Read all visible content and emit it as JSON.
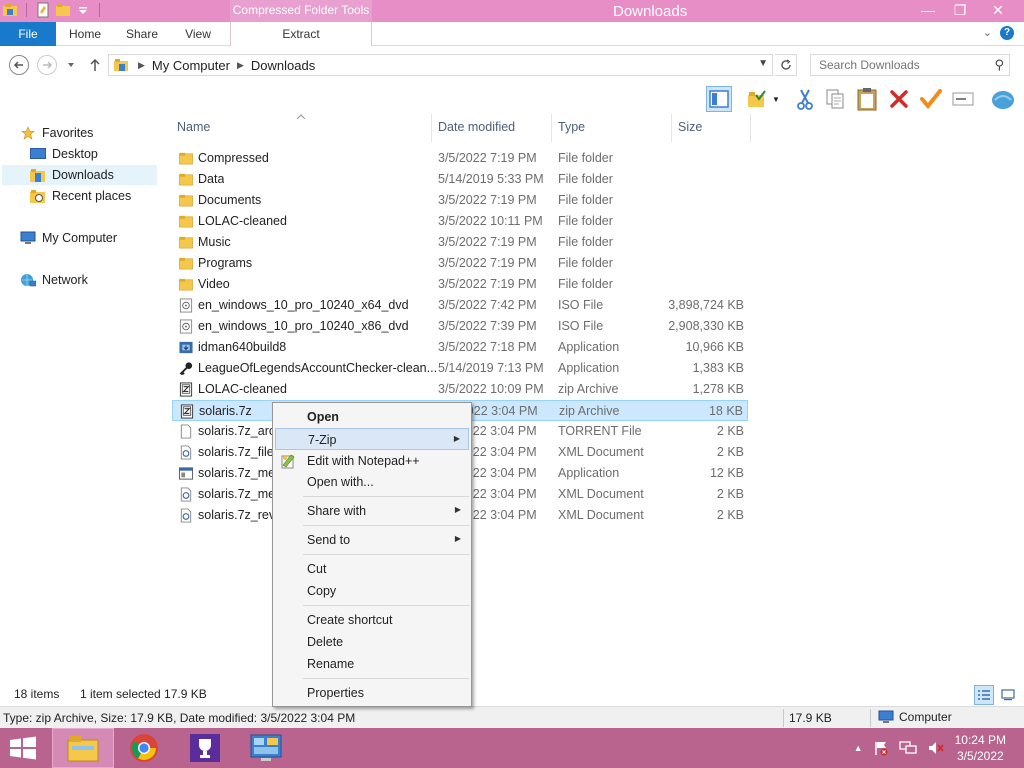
{
  "window": {
    "title": "Downloads",
    "context_tab": "Compressed Folder Tools",
    "minimize_glyph": "—",
    "maximize_glyph": "❐",
    "close_glyph": "✕"
  },
  "ribbon": {
    "tabs": [
      {
        "label": "File"
      },
      {
        "label": "Home"
      },
      {
        "label": "Share"
      },
      {
        "label": "View"
      },
      {
        "label": "Extract"
      }
    ],
    "help_glyph": "?",
    "collapse_glyph": "⌄"
  },
  "address": {
    "crumbs": [
      "My Computer",
      "Downloads"
    ],
    "search_placeholder": "Search Downloads"
  },
  "nav": {
    "favorites": "Favorites",
    "desktop": "Desktop",
    "downloads": "Downloads",
    "recent": "Recent places",
    "computer": "My Computer",
    "network": "Network"
  },
  "columns": {
    "name": "Name",
    "date": "Date modified",
    "type": "Type",
    "size": "Size"
  },
  "files": [
    {
      "name": "Compressed",
      "date": "3/5/2022 7:19 PM",
      "type": "File folder",
      "size": "",
      "icon": "folder-icon"
    },
    {
      "name": "Data",
      "date": "5/14/2019 5:33 PM",
      "type": "File folder",
      "size": "",
      "icon": "folder-icon"
    },
    {
      "name": "Documents",
      "date": "3/5/2022 7:19 PM",
      "type": "File folder",
      "size": "",
      "icon": "folder-icon"
    },
    {
      "name": "LOLAC-cleaned",
      "date": "3/5/2022 10:11 PM",
      "type": "File folder",
      "size": "",
      "icon": "folder-icon"
    },
    {
      "name": "Music",
      "date": "3/5/2022 7:19 PM",
      "type": "File folder",
      "size": "",
      "icon": "folder-icon"
    },
    {
      "name": "Programs",
      "date": "3/5/2022 7:19 PM",
      "type": "File folder",
      "size": "",
      "icon": "folder-icon"
    },
    {
      "name": "Video",
      "date": "3/5/2022 7:19 PM",
      "type": "File folder",
      "size": "",
      "icon": "folder-icon"
    },
    {
      "name": "en_windows_10_pro_10240_x64_dvd",
      "date": "3/5/2022 7:42 PM",
      "type": "ISO File",
      "size": "3,898,724 KB",
      "icon": "disc-image-icon"
    },
    {
      "name": "en_windows_10_pro_10240_x86_dvd",
      "date": "3/5/2022 7:39 PM",
      "type": "ISO File",
      "size": "2,908,330 KB",
      "icon": "disc-image-icon"
    },
    {
      "name": "idman640build8",
      "date": "3/5/2022 7:18 PM",
      "type": "Application",
      "size": "10,966 KB",
      "icon": "installer-icon"
    },
    {
      "name": "LeagueOfLegendsAccountChecker-clean...",
      "date": "5/14/2019 7:13 PM",
      "type": "Application",
      "size": "1,383 KB",
      "icon": "key-icon"
    },
    {
      "name": "LOLAC-cleaned",
      "date": "3/5/2022 10:09 PM",
      "type": "zip Archive",
      "size": "1,278 KB",
      "icon": "zip-icon"
    },
    {
      "name": "solaris.7z",
      "date": "3/5/2022 3:04 PM",
      "type": "zip Archive",
      "size": "18 KB",
      "icon": "zip-icon"
    },
    {
      "name": "solaris.7z_archive.torrent",
      "date": "3/5/2022 3:04 PM",
      "type": "TORRENT File",
      "size": "2 KB",
      "icon": "blank-file-icon"
    },
    {
      "name": "solaris.7z_files.xml",
      "date": "3/5/2022 3:04 PM",
      "type": "XML Document",
      "size": "2 KB",
      "icon": "xml-icon"
    },
    {
      "name": "solaris.7z_meta.sqlite",
      "date": "3/5/2022 3:04 PM",
      "type": "Application",
      "size": "12 KB",
      "icon": "app-file-icon"
    },
    {
      "name": "solaris.7z_meta.xml",
      "date": "3/5/2022 3:04 PM",
      "type": "XML Document",
      "size": "2 KB",
      "icon": "xml-icon"
    },
    {
      "name": "solaris.7z_reviews.xml",
      "date": "3/5/2022 3:04 PM",
      "type": "XML Document",
      "size": "2 KB",
      "icon": "xml-icon"
    }
  ],
  "context_menu": {
    "open": "Open",
    "sevenzip": "7-Zip",
    "notepad": "Edit with Notepad++",
    "openwith": "Open with...",
    "sharewith": "Share with",
    "sendto": "Send to",
    "cut": "Cut",
    "copy": "Copy",
    "shortcut": "Create shortcut",
    "delete": "Delete",
    "rename": "Rename",
    "properties": "Properties",
    "submenu_arrow": "▶"
  },
  "status": {
    "items": "18 items",
    "selected": "1 item selected  17.9 KB"
  },
  "details": {
    "info": "Type: zip Archive, Size: 17.9 KB, Date modified: 3/5/2022 3:04 PM",
    "size": "17.9 KB",
    "location": "Computer"
  },
  "clock": {
    "time": "10:24 PM",
    "date": "3/5/2022"
  },
  "colors": {
    "titlebar": "#e88ec7",
    "taskbar": "#b8648f",
    "file_tab": "#1979ca",
    "selection": "#cce8ff",
    "folder": "#f5c74a"
  }
}
